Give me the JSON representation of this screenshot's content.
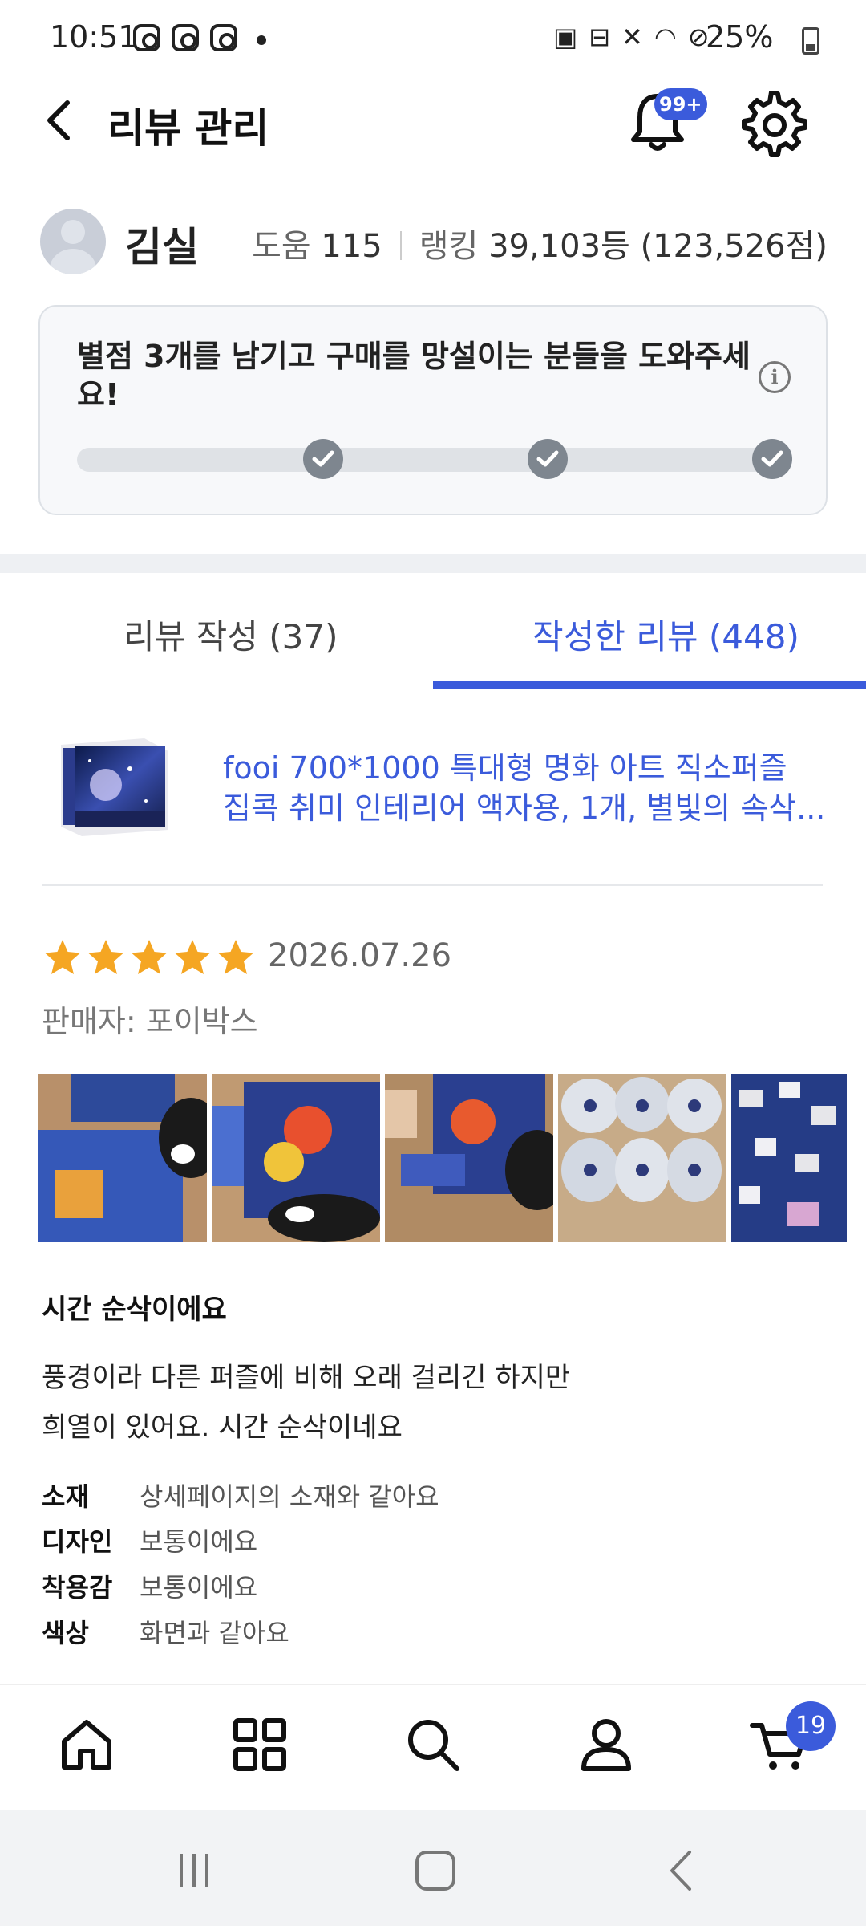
{
  "status_bar": {
    "time": "10:51",
    "battery": "25%"
  },
  "header": {
    "title": "리뷰 관리",
    "notification_badge": "99+"
  },
  "profile": {
    "name": "김실",
    "help_label": "도움",
    "help_count": "115",
    "ranking_label": "랭킹",
    "ranking_value": "39,103등 (123,526점)"
  },
  "mission": {
    "text": "별점 3개를 남기고 구매를 망설이는 분들을 도와주세요!",
    "checks_done": 3,
    "checks_total": 3
  },
  "tabs": [
    {
      "label": "리뷰 작성 (37)",
      "active": false
    },
    {
      "label": "작성한 리뷰 (448)",
      "active": true
    }
  ],
  "product": {
    "title_line1": "fooi 700*1000 특대형 명화 아트 직소퍼즐",
    "title_line2": "집콕 취미 인테리어 액자용, 1개, 별빛의 속삭..."
  },
  "review": {
    "rating": 5,
    "date": "2026.07.26",
    "seller": "판매자: 포이박스",
    "headline": "시간 순삭이에요",
    "body_line1": "풍경이라 다른 퍼즐에 비해 오래 걸리긴 하지만",
    "body_line2": "희열이 있어요. 시간 순삭이네요",
    "survey": [
      {
        "key": "소재",
        "value": "상세페이지의 소재와 같아요"
      },
      {
        "key": "디자인",
        "value": "보통이에요"
      },
      {
        "key": "착용감",
        "value": "보통이에요"
      },
      {
        "key": "색상",
        "value": "화면과 같아요"
      }
    ]
  },
  "bottom_nav": {
    "cart_badge": "19"
  },
  "colors": {
    "accent": "#3b5bdb",
    "star": "#f5a623"
  }
}
